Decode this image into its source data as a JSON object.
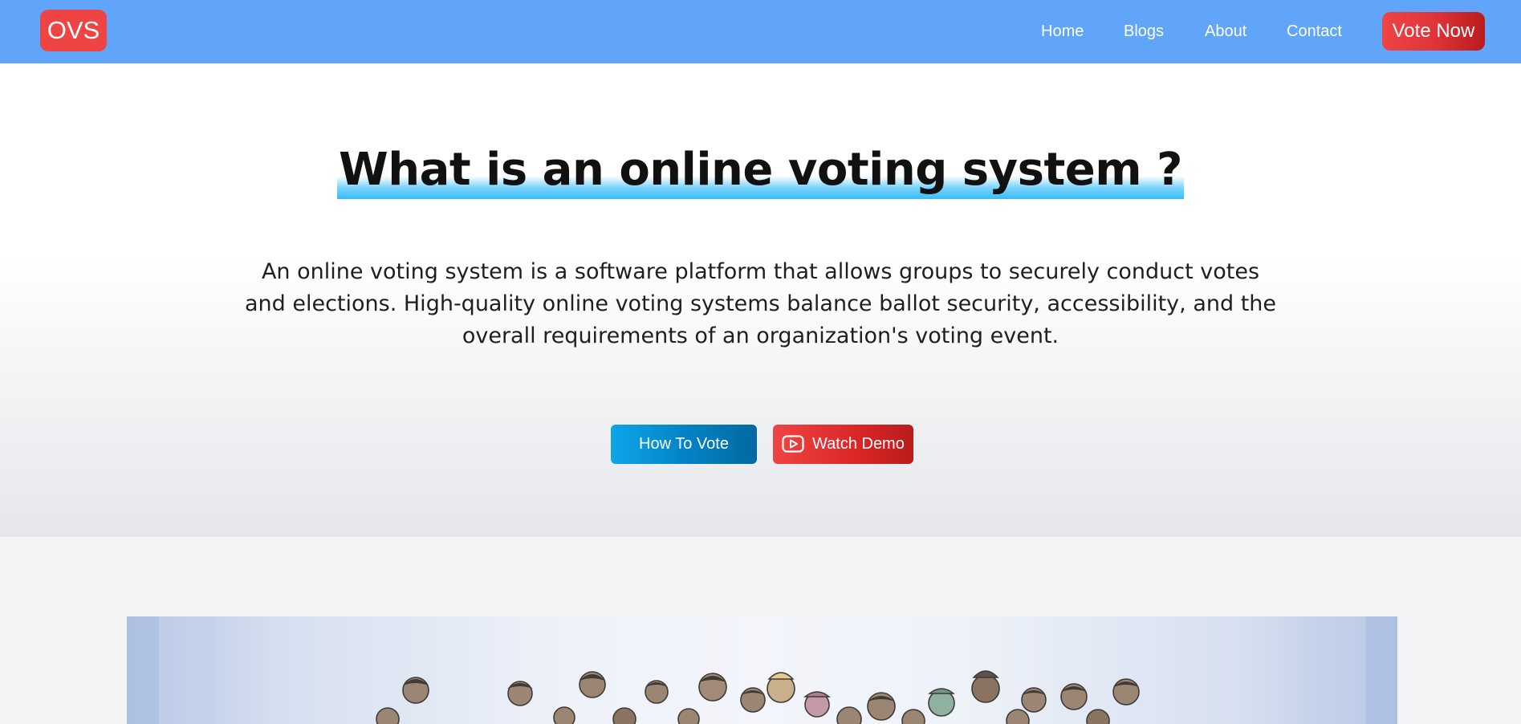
{
  "navbar": {
    "logo": "OVS",
    "links": [
      "Home",
      "Blogs",
      "About",
      "Contact"
    ],
    "cta": "Vote Now"
  },
  "hero": {
    "title": "What is an online voting system ?",
    "description": "An online voting system is a software platform that allows groups to securely conduct votes and elections. High-quality online voting systems balance ballot security, accessibility, and the overall requirements of an organization's voting event.",
    "buttons": {
      "how_to_vote": "How To Vote",
      "watch_demo": "Watch Demo",
      "watch_demo_icon": "youtube-play-icon"
    }
  },
  "illustration": {
    "subject": "crowd-of-voters-illustration"
  },
  "colors": {
    "navbar_bg": "#60a5fa",
    "logo_bg": "#ef4444",
    "vote_now": "#dc2626",
    "how_to_vote": "#0284c7",
    "watch_demo": "#dc2626",
    "title_highlight": "#38bdf8"
  }
}
